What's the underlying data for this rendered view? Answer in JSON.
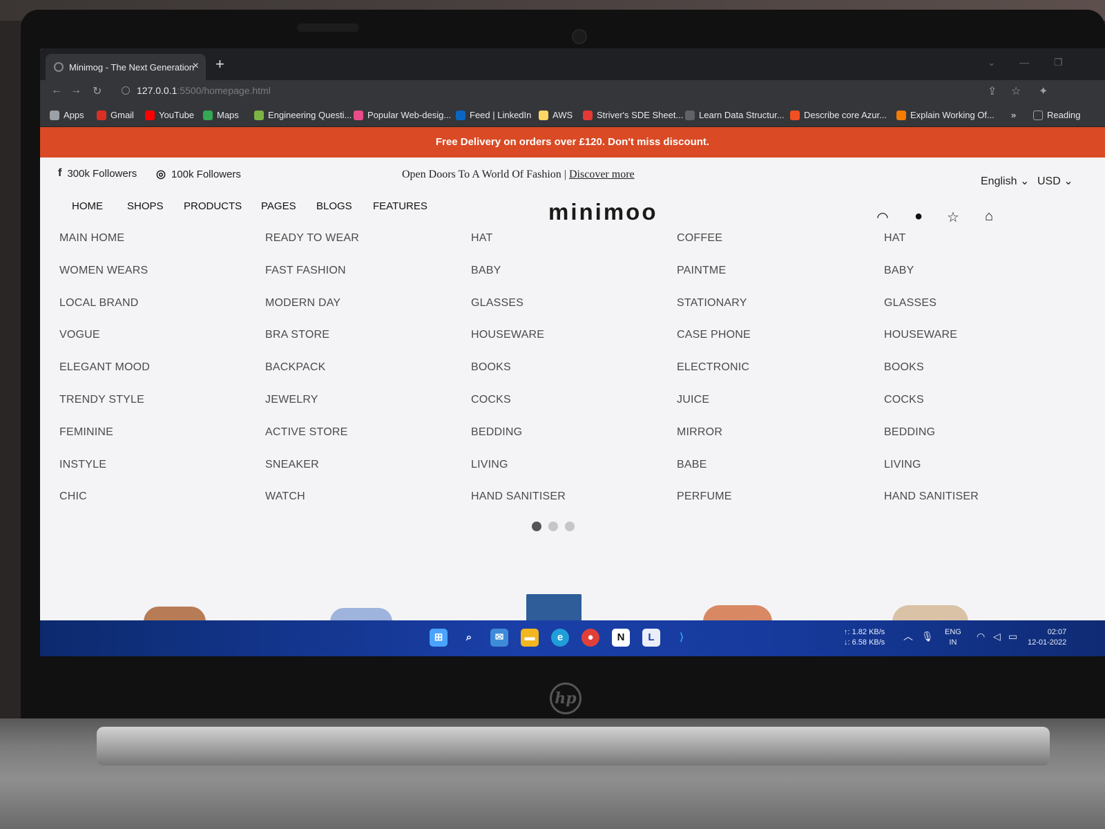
{
  "browser": {
    "tab_title": "Minimog - The Next Generation",
    "tab_close": "×",
    "new_tab": "+",
    "url_host": "127.0.0.1",
    "url_path": ":5500/homepage.html",
    "bookmarks": [
      {
        "label": "Apps",
        "icon": "apps-grid-icon",
        "color": "#9aa0a6"
      },
      {
        "label": "Gmail",
        "icon": "gmail-icon",
        "color": "#d93025"
      },
      {
        "label": "YouTube",
        "icon": "youtube-icon",
        "color": "#ff0000"
      },
      {
        "label": "Maps",
        "icon": "maps-icon",
        "color": "#34a853"
      },
      {
        "label": "Engineering Questi...",
        "icon": "leaf-icon",
        "color": "#7cb342"
      },
      {
        "label": "Popular Web-desig...",
        "icon": "dribbble-icon",
        "color": "#ea4c89"
      },
      {
        "label": "Feed | LinkedIn",
        "icon": "linkedin-icon",
        "color": "#0a66c2"
      },
      {
        "label": "AWS",
        "icon": "folder-icon",
        "color": "#fdd663"
      },
      {
        "label": "Striver's SDE Sheet...",
        "icon": "tuf-icon",
        "color": "#e53935"
      },
      {
        "label": "Learn Data Structur...",
        "icon": "cc-icon",
        "color": "#5f6368"
      },
      {
        "label": "Describe core Azur...",
        "icon": "microsoft-icon",
        "color": "#f25022"
      },
      {
        "label": "Explain Working Of...",
        "icon": "hook-icon",
        "color": "#f57c00"
      }
    ],
    "bookmarks_more": "»",
    "reading_list": "Reading"
  },
  "site": {
    "promo": "Free Delivery on orders over £120. Don't miss discount.",
    "facebook_followers": "300k Followers",
    "instagram_followers": "100k Followers",
    "tagline": "Open Doors To A World Of Fashion | ",
    "discover_link": "Discover more",
    "language": "English",
    "currency": "USD",
    "nav": [
      "HOME",
      "SHOPS",
      "PRODUCTS",
      "PAGES",
      "BLOGS",
      "FEATURES"
    ],
    "logo": "minimoo"
  },
  "mega_menu": {
    "col1": [
      "MAIN HOME",
      "WOMEN WEARS",
      "LOCAL BRAND",
      "VOGUE",
      "ELEGANT MOOD",
      "TRENDY STYLE",
      "FEMININE",
      "INSTYLE",
      "CHIC"
    ],
    "col2": [
      "READY TO WEAR",
      "FAST FASHION",
      "MODERN DAY",
      "BRA STORE",
      "BACKPACK",
      "JEWELRY",
      "ACTIVE STORE",
      "SNEAKER",
      "WATCH"
    ],
    "col3": [
      "HAT",
      "BABY",
      "GLASSES",
      "HOUSEWARE",
      "BOOKS",
      "COCKS",
      "BEDDING",
      "LIVING",
      "HAND SANITISER"
    ],
    "col4": [
      "COFFEE",
      "PAINTME",
      "STATIONARY",
      "CASE PHONE",
      "ELECTRONIC",
      "JUICE",
      "MIRROR",
      "BABE",
      "PERFUME"
    ],
    "col5": [
      "HAT",
      "BABY",
      "GLASSES",
      "HOUSEWARE",
      "BOOKS",
      "COCKS",
      "BEDDING",
      "LIVING",
      "HAND SANITISER"
    ]
  },
  "taskbar": {
    "upload": "↑: 1.82 KB/s",
    "download": "↓: 6.58 KB/s",
    "lang1": "ENG",
    "lang2": "IN",
    "time": "02:07",
    "date": "12-01-2022"
  },
  "device": {
    "brand": "hp"
  },
  "colors": {
    "promo_bg": "#d94a25",
    "page_bg": "#f4f4f6",
    "taskbar": "#1a3fa8"
  }
}
